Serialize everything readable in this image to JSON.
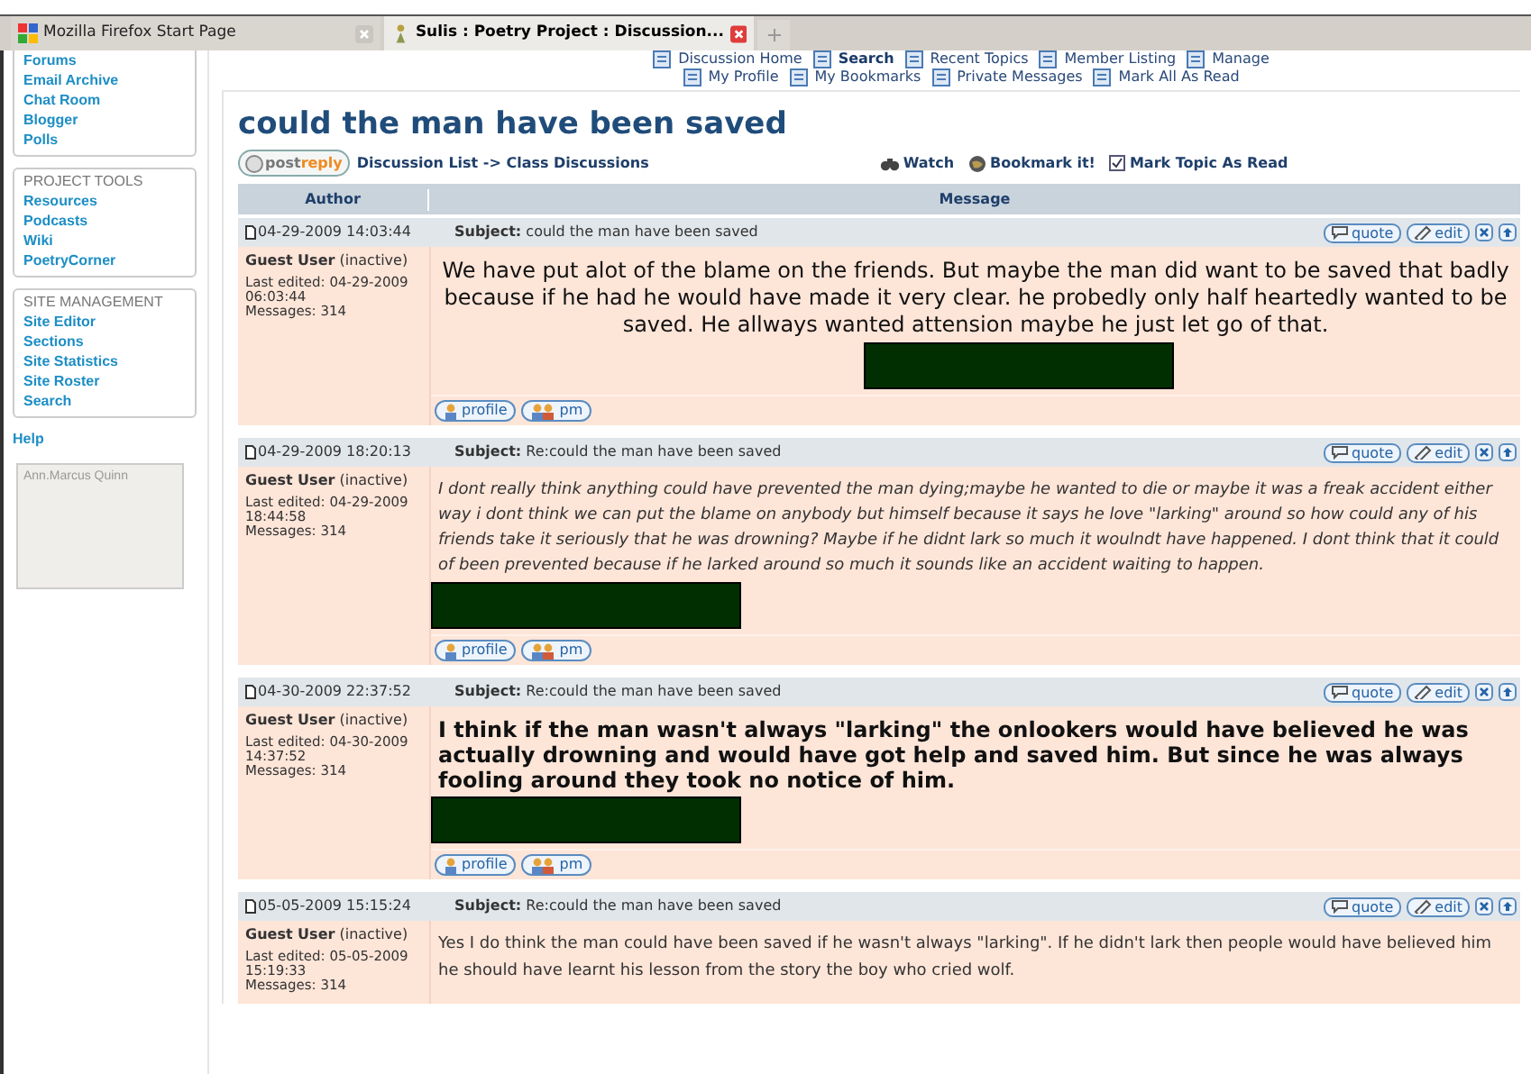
{
  "browser_tabs": [
    {
      "title": "Mozilla Firefox Start Page",
      "selected": false
    },
    {
      "title": "Sulis : Poetry Project : Discussion...",
      "selected": true
    }
  ],
  "sidebar": {
    "sections": [
      {
        "links": [
          "Forums",
          "Email Archive",
          "Chat Room",
          "Blogger",
          "Polls"
        ]
      },
      {
        "heading": "PROJECT TOOLS",
        "links": [
          "Resources",
          "Podcasts",
          "Wiki",
          "PoetryCorner"
        ]
      },
      {
        "heading": "SITE MANAGEMENT",
        "links": [
          "Site Editor",
          "Sections",
          "Site Statistics",
          "Site Roster",
          "Search"
        ]
      }
    ],
    "help": "Help",
    "user_box": "Ann.Marcus Quinn"
  },
  "top_nav": [
    [
      {
        "label": "Discussion Home",
        "selected": false
      },
      {
        "label": "Search",
        "selected": true
      },
      {
        "label": "Recent Topics",
        "selected": false
      },
      {
        "label": "Member Listing",
        "selected": false
      },
      {
        "label": "Manage",
        "selected": false
      }
    ],
    [
      {
        "label": "My Profile",
        "selected": false
      },
      {
        "label": "My Bookmarks",
        "selected": false
      },
      {
        "label": "Private Messages",
        "selected": false
      },
      {
        "label": "Mark All As Read",
        "selected": false
      }
    ]
  ],
  "title": "could the man have been saved",
  "post_reply": [
    "post",
    "reply"
  ],
  "breadcrumb": "Discussion List -> Class Discussions",
  "topic_actions": [
    {
      "label": "Watch",
      "kind": "watch"
    },
    {
      "label": "Bookmark it!",
      "kind": "bookmark"
    },
    {
      "label": "Mark Topic As Read",
      "kind": "check"
    }
  ],
  "columns": [
    "Author",
    "Message"
  ],
  "posts": [
    {
      "date": "04-29-2009 14:03:44",
      "subject_label": "Subject:",
      "subject": "could the man have been saved",
      "author": "Guest User",
      "status": "(inactive)",
      "edited": "Last edited: 04-29-2009",
      "edited_time": "06:03:44",
      "messages": "Messages: 314",
      "kind": "large-centered",
      "message": "We have put alot of the blame on the friends. But maybe the man did want to be saved that badly because if he had he would have made it very clear. he probedly only half heartedly wanted to be saved. He allways wanted attension maybe he just let go of that.",
      "actions": [
        "quote",
        "edit"
      ],
      "contact": [
        "profile",
        "pm"
      ],
      "redacted": true
    },
    {
      "date": "04-29-2009 18:20:13",
      "subject_label": "Subject:",
      "subject": "Re:could the man have been saved",
      "author": "Guest User",
      "status": "(inactive)",
      "edited": "Last edited: 04-29-2009",
      "edited_time": "18:44:58",
      "messages": "Messages: 314",
      "kind": "italic",
      "message": "I dont really think anything could have prevented the man dying;maybe he wanted to die or maybe it was a freak accident either way i dont think we can put the blame on anybody but himself because it says he love \"larking\"  around so how could any of his friends take it seriously that he was drowning? Maybe if he didnt lark so much it woulndt have happened.  I dont think that it could of been prevented because if he larked around so much it sounds like an accident waiting to happen.",
      "actions": [
        "quote",
        "edit"
      ],
      "contact": [
        "profile",
        "pm"
      ],
      "redacted": true
    },
    {
      "date": "04-30-2009 22:37:52",
      "subject_label": "Subject:",
      "subject": "Re:could the man have been saved",
      "author": "Guest User",
      "status": "(inactive)",
      "edited": "Last edited: 04-30-2009",
      "edited_time": "14:37:52",
      "messages": "Messages: 314",
      "kind": "large-bold",
      "message": "I think if the man wasn't always \"larking\" the onlookers would have believed he was actually drowning and would have got help and saved him. But since he was always fooling around they took no notice of him.",
      "actions": [
        "quote",
        "edit"
      ],
      "contact": [
        "profile",
        "pm"
      ],
      "redacted": true
    },
    {
      "date": "05-05-2009 15:15:24",
      "subject_label": "Subject:",
      "subject": "Re:could the man have been saved",
      "author": "Guest User",
      "status": "(inactive)",
      "edited": "Last edited: 05-05-2009",
      "edited_time": "15:19:33",
      "messages": "Messages: 314",
      "kind": "normal",
      "message": "Yes I do think the man could have been saved if he wasn't always \"larking\". If he didn't lark then people would have believed him he should have learnt his lesson from the story the boy who cried wolf.",
      "actions": [
        "quote",
        "edit"
      ]
    }
  ]
}
